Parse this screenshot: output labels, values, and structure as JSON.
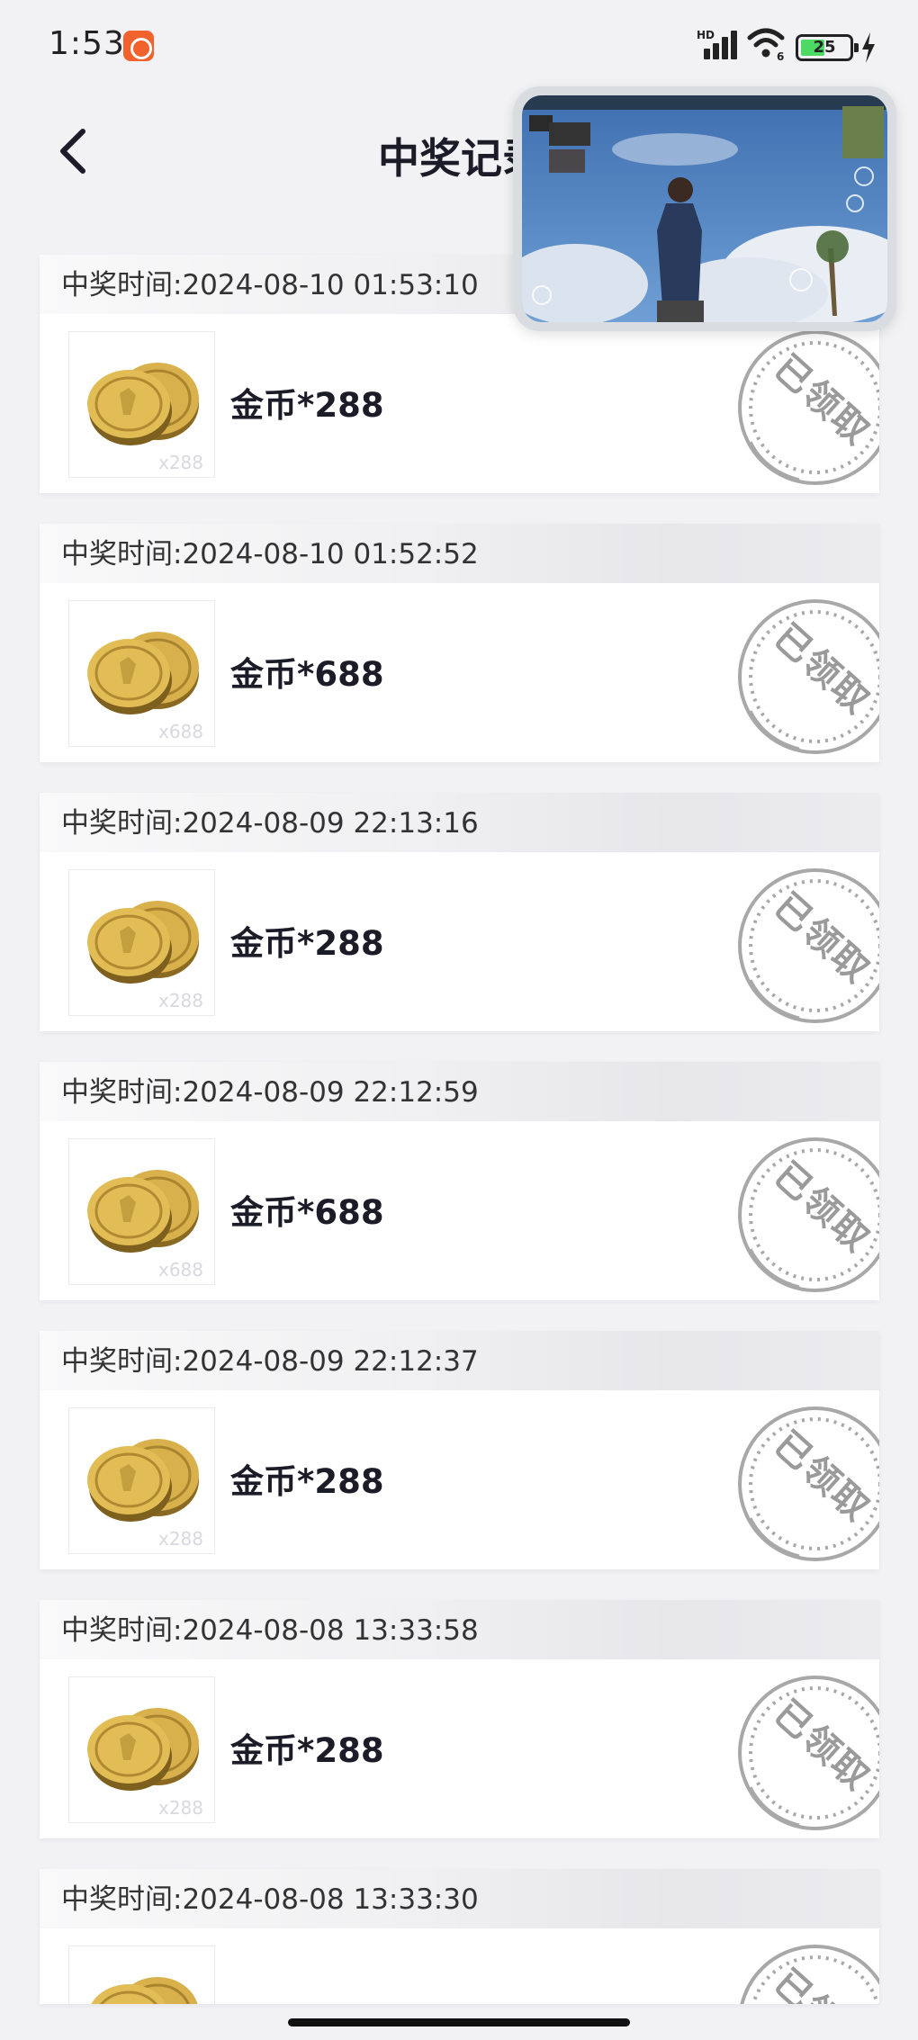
{
  "status_bar": {
    "time": "1:53",
    "network_label": "HD",
    "wifi_label": "6",
    "battery_percent": "25",
    "icons": [
      "app-notification-icon",
      "signal-icon",
      "wifi-icon",
      "battery-icon",
      "charging-icon"
    ]
  },
  "nav": {
    "title": "中奖记录",
    "back_icon": "chevron-left-icon"
  },
  "pip": {
    "label": "floating-game-video"
  },
  "records": [
    {
      "time_label": "中奖时间:2024-08-10 01:53:10",
      "prize": "金币*288",
      "badge": "x288",
      "status": "已领取"
    },
    {
      "time_label": "中奖时间:2024-08-10 01:52:52",
      "prize": "金币*688",
      "badge": "x688",
      "status": "已领取"
    },
    {
      "time_label": "中奖时间:2024-08-09 22:13:16",
      "prize": "金币*288",
      "badge": "x288",
      "status": "已领取"
    },
    {
      "time_label": "中奖时间:2024-08-09 22:12:59",
      "prize": "金币*688",
      "badge": "x688",
      "status": "已领取"
    },
    {
      "time_label": "中奖时间:2024-08-09 22:12:37",
      "prize": "金币*288",
      "badge": "x288",
      "status": "已领取"
    },
    {
      "time_label": "中奖时间:2024-08-08 13:33:58",
      "prize": "金币*288",
      "badge": "x288",
      "status": "已领取"
    },
    {
      "time_label": "中奖时间:2024-08-08 13:33:30",
      "prize": "",
      "badge": "",
      "status": "已领取"
    }
  ],
  "colors": {
    "background": "#f2f2f4",
    "card": "#ffffff",
    "title_text": "#1c1c28",
    "stamp": "#9a9a9a",
    "coin_gold": "#d4a93a"
  }
}
